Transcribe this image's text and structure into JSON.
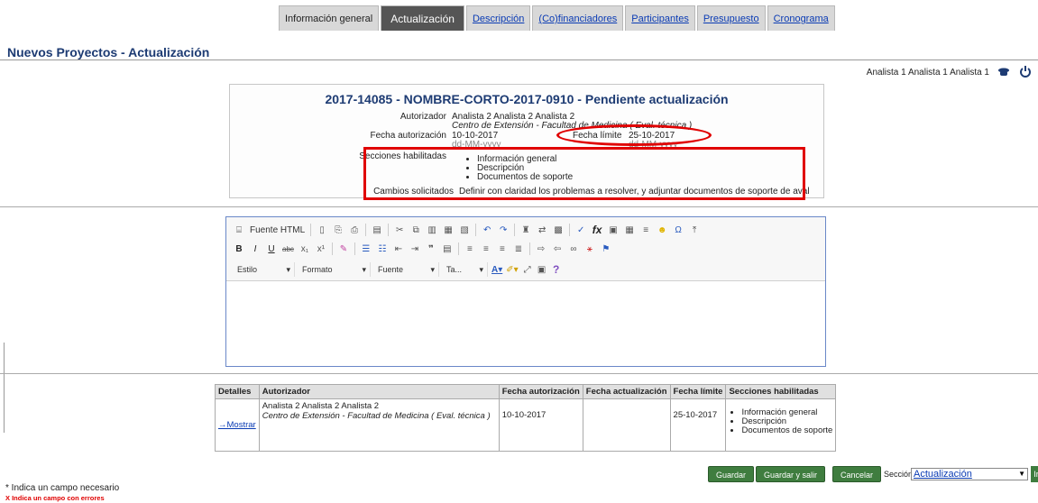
{
  "tabs": [
    {
      "label": "Información general"
    },
    {
      "label": "Actualización"
    },
    {
      "label": "Descripción"
    },
    {
      "label": "(Co)financiadores"
    },
    {
      "label": "Participantes"
    },
    {
      "label": "Presupuesto"
    },
    {
      "label": "Cronograma"
    }
  ],
  "page": {
    "title": "Nuevos Proyectos - Actualización"
  },
  "user": {
    "name": "Analista 1 Analista 1 Analista 1"
  },
  "icons": {
    "user": "user-icon",
    "logout": "power-icon"
  },
  "project": {
    "title": "2017-14085 - NOMBRE-CORTO-2017-0910 - Pendiente actualización",
    "autorizador_label": "Autorizador",
    "autorizador_name": "Analista 2 Analista 2 Analista 2",
    "autorizador_unit": "Centro de Extensión - Facultad de Medicina ( Eval. técnica )",
    "fecha_aut_label": "Fecha autorización",
    "fecha_aut_value": "10-10-2017",
    "fecha_aut_format": "dd-MM-yyyy",
    "fecha_lim_label": "Fecha límite",
    "fecha_lim_value": "25-10-2017",
    "fecha_lim_format": "dd-MM-yyyy",
    "secciones_label": "Secciones habilitadas",
    "secciones": [
      "Información general",
      "Descripción",
      "Documentos de soporte"
    ],
    "cambios_label": "Cambios solicitados",
    "cambios_value": "Definir con claridad los problemas a resolver, y adjuntar documentos de soporte de aval"
  },
  "editor": {
    "source_label": "Fuente HTML",
    "combos": [
      "Estilo",
      "Formato",
      "Fuente",
      "Ta..."
    ]
  },
  "history": {
    "headers": [
      "Detalles",
      "Autorizador",
      "Fecha autorización",
      "Fecha actualización",
      "Fecha límite",
      "Secciones habilitadas"
    ],
    "row": {
      "detalles": "→Mostrar",
      "autorizador_name": "Analista 2 Analista 2 Analista 2",
      "autorizador_unit": "Centro de Extensión - Facultad de Medicina ( Eval. técnica )",
      "fecha_aut": "10-10-2017",
      "fecha_act": "",
      "fecha_lim": "25-10-2017",
      "secciones": [
        "Información general",
        "Descripción",
        "Documentos de soporte"
      ]
    }
  },
  "actions": {
    "guardar": "Guardar",
    "guardar_salir": "Guardar y salir",
    "cancelar": "Cancelar",
    "section_label": "Sección",
    "section_value": "Actualización",
    "go": "Ir"
  },
  "notes": {
    "required": "* Indica un campo necesario",
    "errors": "X Indica un campo con errores"
  },
  "colors": {
    "accent": "#1d3b73",
    "button": "#3f7d3f",
    "highlight": "#e00000"
  }
}
